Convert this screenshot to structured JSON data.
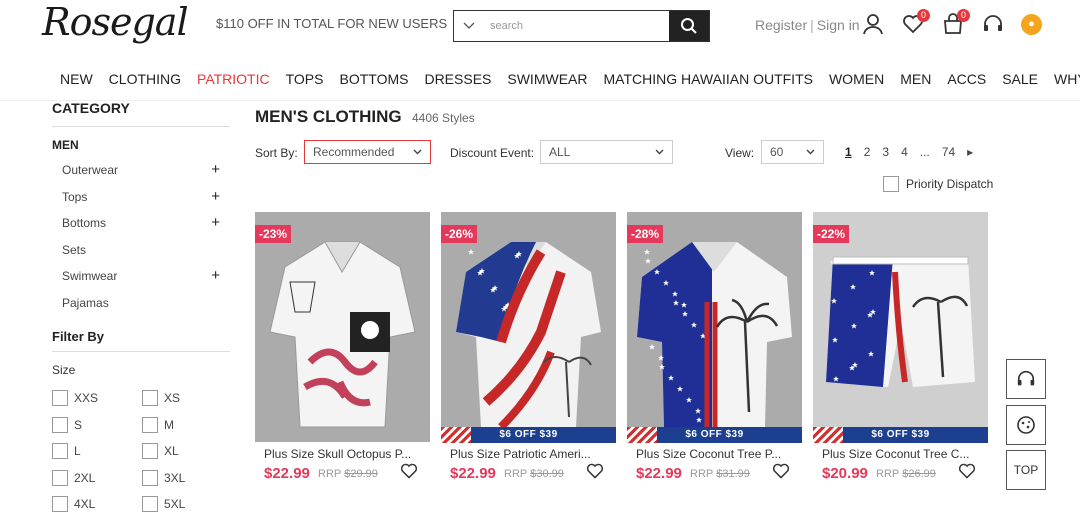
{
  "header": {
    "logo": "Rosegal",
    "promo": "$110 OFF IN TOTAL FOR NEW USERS",
    "search_placeholder": "search",
    "register": "Register",
    "separator": "|",
    "signin": "Sign in",
    "wishlist_count": "0",
    "cart_count": "0"
  },
  "nav": [
    "NEW",
    "CLOTHING",
    "PATRIOTIC",
    "TOPS",
    "BOTTOMS",
    "DRESSES",
    "SWIMWEAR",
    "MATCHING HAWAIIAN OUTFITS",
    "WOMEN",
    "MEN",
    "ACCS",
    "SALE",
    "WHY ROSEGAL"
  ],
  "sidebar": {
    "category_title": "CATEGORY",
    "men": "MEN",
    "items": [
      {
        "label": "Outerwear",
        "expand": "+"
      },
      {
        "label": "Tops",
        "expand": "+"
      },
      {
        "label": "Bottoms",
        "expand": "+"
      },
      {
        "label": "Sets",
        "expand": ""
      },
      {
        "label": "Swimwear",
        "expand": "+"
      },
      {
        "label": "Pajamas",
        "expand": ""
      }
    ],
    "filter_title": "Filter By",
    "size_label": "Size",
    "sizes": [
      "XXS",
      "XS",
      "S",
      "M",
      "L",
      "XL",
      "2XL",
      "3XL",
      "4XL",
      "5XL"
    ]
  },
  "main": {
    "title": "MEN'S CLOTHING",
    "count": "4406 Styles",
    "sort_label": "Sort By:",
    "sort_value": "Recommended",
    "discount_label": "Discount Event:",
    "discount_value": "ALL",
    "view_label": "View:",
    "view_value": "60",
    "pages": [
      "1",
      "2",
      "3",
      "4",
      "...",
      "74",
      "▸"
    ],
    "priority": "Priority Dispatch"
  },
  "products": [
    {
      "discount": "-23%",
      "name": "Plus Size Skull Octopus P...",
      "price": "$22.99",
      "rrp_label": "RRP",
      "rrp": "$29.99",
      "promo": "",
      "image": "skull-octopus-shirt"
    },
    {
      "discount": "-26%",
      "name": "Plus Size Patriotic Ameri...",
      "price": "$22.99",
      "rrp_label": "RRP",
      "rrp": "$30.99",
      "promo": "$6 OFF $39",
      "image": "patriotic-flag-shirt"
    },
    {
      "discount": "-28%",
      "name": "Plus Size Coconut Tree P...",
      "price": "$22.99",
      "rrp_label": "RRP",
      "rrp": "$31.99",
      "promo": "$6 OFF $39",
      "image": "coconut-tree-shirt"
    },
    {
      "discount": "-22%",
      "name": "Plus Size Coconut Tree C...",
      "price": "$20.99",
      "rrp_label": "RRP",
      "rrp": "$26.99",
      "promo": "$6 OFF $39",
      "image": "coconut-tree-shorts"
    }
  ],
  "float": {
    "top": "TOP"
  },
  "colors": {
    "accent": "#e4393c",
    "discount": "#e4395a",
    "promo_strip": "#1c3f8f"
  }
}
